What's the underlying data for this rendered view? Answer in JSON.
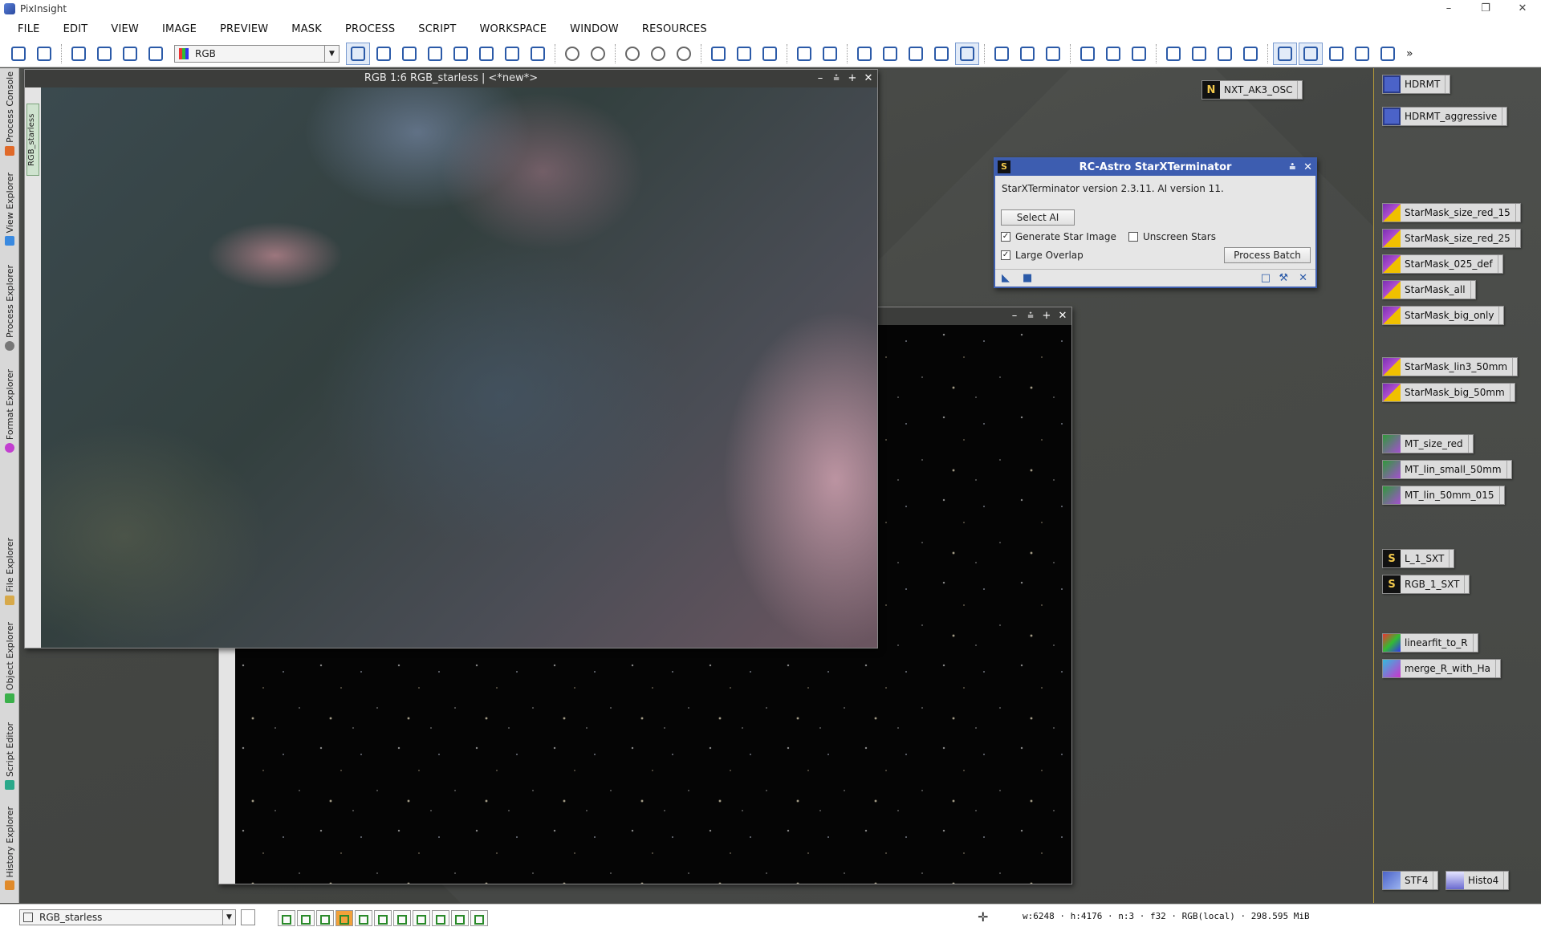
{
  "app": {
    "title": "PixInsight"
  },
  "window_controls": {
    "minimize": "–",
    "restore": "❐",
    "close": "✕"
  },
  "menu": [
    "FILE",
    "EDIT",
    "VIEW",
    "IMAGE",
    "PREVIEW",
    "MASK",
    "PROCESS",
    "SCRIPT",
    "WORKSPACE",
    "WINDOW",
    "RESOURCES"
  ],
  "toolbar": {
    "rgb_mode": "RGB",
    "overflow": "»"
  },
  "left_tabs": {
    "process_console": "Process Console",
    "view_explorer": "View Explorer",
    "process_explorer": "Process Explorer",
    "format_explorer": "Format Explorer",
    "file_explorer": "File Explorer",
    "object_explorer": "Object Explorer",
    "script_editor": "Script Editor",
    "history_explorer": "History Explorer"
  },
  "image_windows": {
    "starless": {
      "title": "RGB 1:6 RGB_starless | <*new*>",
      "side_tab": "RGB_starless"
    },
    "stars": {
      "title": ""
    }
  },
  "iw_controls": {
    "min": "–",
    "shade": "⩮",
    "max": "+",
    "close": "✕"
  },
  "sxt_dialog": {
    "title": "RC-Astro StarXTerminator",
    "badge": "S",
    "version_text": "StarXTerminator version 2.3.11. AI version 11.",
    "select_ai": "Select AI",
    "generate_star_image": {
      "label": "Generate Star Image",
      "checked": true
    },
    "unscreen_stars": {
      "label": "Unscreen Stars",
      "checked": false
    },
    "large_overlap": {
      "label": "Large Overlap",
      "checked": true
    },
    "process_batch": "Process Batch",
    "check_mark": "✓"
  },
  "workspace_icons": {
    "nxt": {
      "label": "NXT_AK3_OSC",
      "badge": "N"
    }
  },
  "shelf_icons": {
    "hdrmt": "HDRMT",
    "hdrmt_aggressive": "HDRMT_aggressive",
    "starmask_size_red_15": "StarMask_size_red_15",
    "starmask_size_red_25": "StarMask_size_red_25",
    "starmask_025_def": "StarMask_025_def",
    "starmask_all": "StarMask_all",
    "starmask_big_only": "StarMask_big_only",
    "starmask_lin3_50mm": "StarMask_lin3_50mm",
    "starmask_big_50mm": "StarMask_big_50mm",
    "mt_size_red": "MT_size_red",
    "mt_lin_small_50mm": "MT_lin_small_50mm",
    "mt_lin_50mm_015": "MT_lin_50mm_015",
    "l_1_sxt": "L_1_SXT",
    "rgb_1_sxt": "RGB_1_SXT",
    "linearfit_to_r": "linearfit_to_R",
    "merge_r_with_ha": "merge_R_with_Ha",
    "stf4": "STF4",
    "histo4": "Histo4",
    "s_badge": "S"
  },
  "statusbar": {
    "view_name": "RGB_starless",
    "image_info": "w:6248 · h:4176 · n:3 · f32 · RGB(local) · 298.595 MiB"
  },
  "colors": {
    "dialog_title": "#3d5db0",
    "workspace_bg": "#4a4c49",
    "accent": "#2b5aa8"
  }
}
